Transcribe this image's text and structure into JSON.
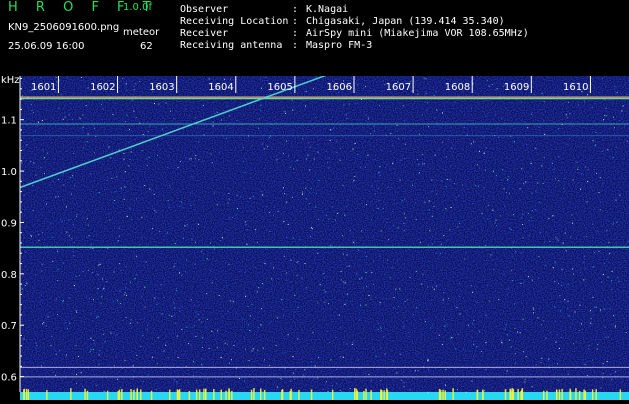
{
  "header": {
    "app_name": "H R O F F T",
    "version": "1.0.0f",
    "filename": "KN9_2506091600.png",
    "datetime": "25.06.09 16:00",
    "meteor_label": "meteor",
    "meteor_count": "62"
  },
  "info": [
    {
      "label": "Observer",
      "value": "K.Nagai"
    },
    {
      "label": "Receiving Location",
      "value": "Chigasaki, Japan (139.414 35.340)"
    },
    {
      "label": "Receiver",
      "value": "AirSpy mini (Miakejima VOR 108.65MHz)"
    },
    {
      "label": "Receiving antenna",
      "value": "Maspro FM-3"
    }
  ],
  "spectrogram": {
    "unit_label": "kHz",
    "x_ticks": [
      "1601",
      "1602",
      "1603",
      "1604",
      "1605",
      "1606",
      "1607",
      "1608",
      "1609",
      "1610"
    ],
    "y_ticks": [
      "1.1",
      "1.0",
      "0.9",
      "0.8",
      "0.7",
      "0.6"
    ],
    "x_range": [
      1600.35,
      1610.5
    ],
    "y_range": [
      0.57,
      1.185
    ],
    "colors": {
      "background": "#000000",
      "noise_base": "#0b0f5a",
      "accent_green": "#21e05c",
      "signal_cyan": "#4fd8d0",
      "bottom_band": "#28d8f0"
    }
  }
}
